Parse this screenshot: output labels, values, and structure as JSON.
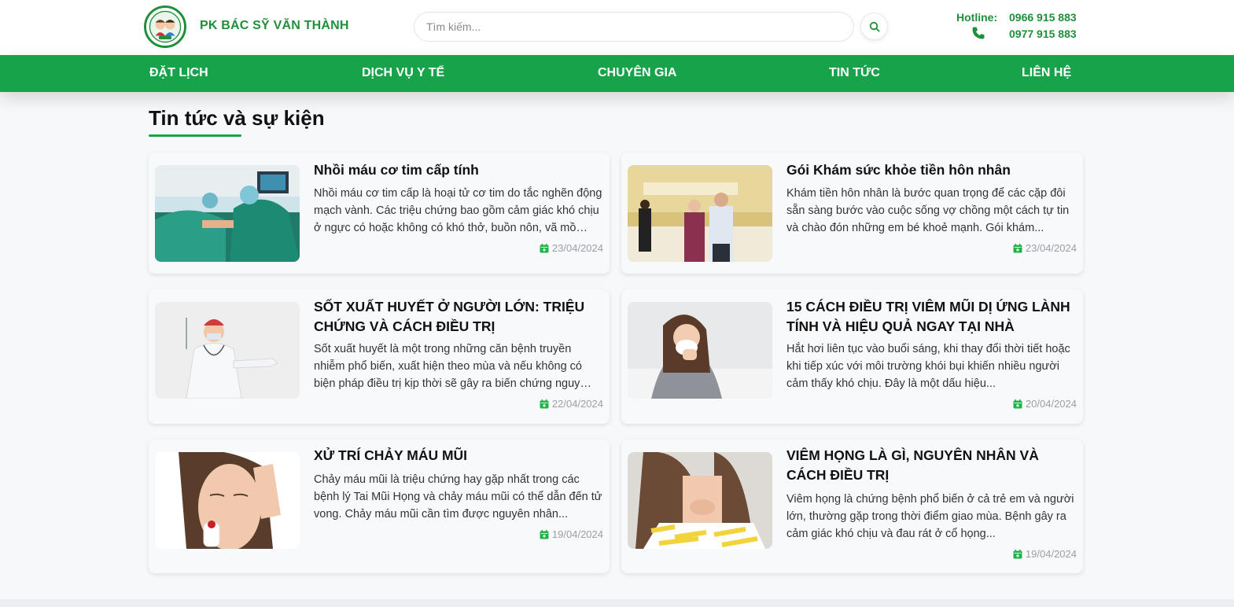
{
  "header": {
    "brand": "PK BÁC SỸ VĂN THÀNH",
    "search_placeholder": "Tìm kiếm...",
    "hotline_label": "Hotline:",
    "phones": [
      "0966 915 883",
      "0977 915 883"
    ]
  },
  "nav": {
    "items": [
      "ĐẶT LỊCH",
      "DỊCH VỤ Y TẾ",
      "CHUYÊN GIA",
      "TIN TỨC",
      "LIÊN HỆ"
    ]
  },
  "section": {
    "title": "Tin tức và sự kiện"
  },
  "articles": [
    {
      "title": "Nhồi máu cơ tim cấp tính",
      "desc": "Nhồi máu cơ tim cấp là hoại tử cơ tim do tắc nghẽn động mạch vành. Các triệu chứng bao gồm cảm giác khó chịu ở ngực có hoặc không có khó thở, buồn nôn, vã mồ hôi...",
      "date": "23/04/2024",
      "image": "surgery-photo"
    },
    {
      "title": "Gói Khám sức khỏe tiền hôn nhân",
      "desc": "Khám tiền hôn nhân là bước quan trọng để các cặp đôi sẵn sàng bước vào cuộc sống vợ chồng một cách tự tin và chào đón những em bé khoẻ mạnh. Gói khám...",
      "date": "23/04/2024",
      "image": "clinic-couple-photo"
    },
    {
      "title": "SỐT XUẤT HUYẾT Ở NGƯỜI LỚN: TRIỆU CHỨNG VÀ CÁCH ĐIỀU TRỊ",
      "desc": "Sốt xuất huyết là một trong những căn bệnh truyền nhiễm phổ biến, xuất hiện theo mùa và nếu không có biện pháp điều trị kịp thời sẽ gây ra biến chứng nguy hiểm...",
      "date": "22/04/2024",
      "image": "doctor-syringe-photo"
    },
    {
      "title": "15 CÁCH ĐIỀU TRỊ VIÊM MŨI DỊ ỨNG LÀNH TÍNH VÀ HIỆU QUẢ NGAY TẠI NHÀ",
      "desc": "Hắt hơi liên tục vào buổi sáng, khi thay đổi thời tiết hoặc khi tiếp xúc với môi trường khói bụi khiến nhiều người cảm thấy khó chịu. Đây là một dấu hiệu...",
      "date": "20/04/2024",
      "image": "woman-sneezing-photo"
    },
    {
      "title": "XỬ TRÍ CHẢY MÁU MŨI",
      "desc": "Chảy máu mũi là triệu chứng hay gặp nhất trong các bệnh lý Tai Mũi Họng và chảy máu mũi có thể dẫn đến tử vong. Chảy máu mũi cần tìm được nguyên nhân...",
      "date": "19/04/2024",
      "image": "nosebleed-photo"
    },
    {
      "title": "VIÊM HỌNG LÀ GÌ, NGUYÊN NHÂN VÀ CÁCH ĐIỀU TRỊ",
      "desc": "Viêm họng là chứng bệnh phổ biến ở cả trẻ em và người lớn, thường gặp trong thời điểm giao mùa. Bệnh gây ra cảm giác khó chịu và đau rát ở cổ họng...",
      "date": "19/04/2024",
      "image": "sore-throat-photo"
    }
  ],
  "colors": {
    "brand_green": "#1f8f3a",
    "nav_green": "#16a349",
    "date_icon_green": "#22b24c"
  }
}
